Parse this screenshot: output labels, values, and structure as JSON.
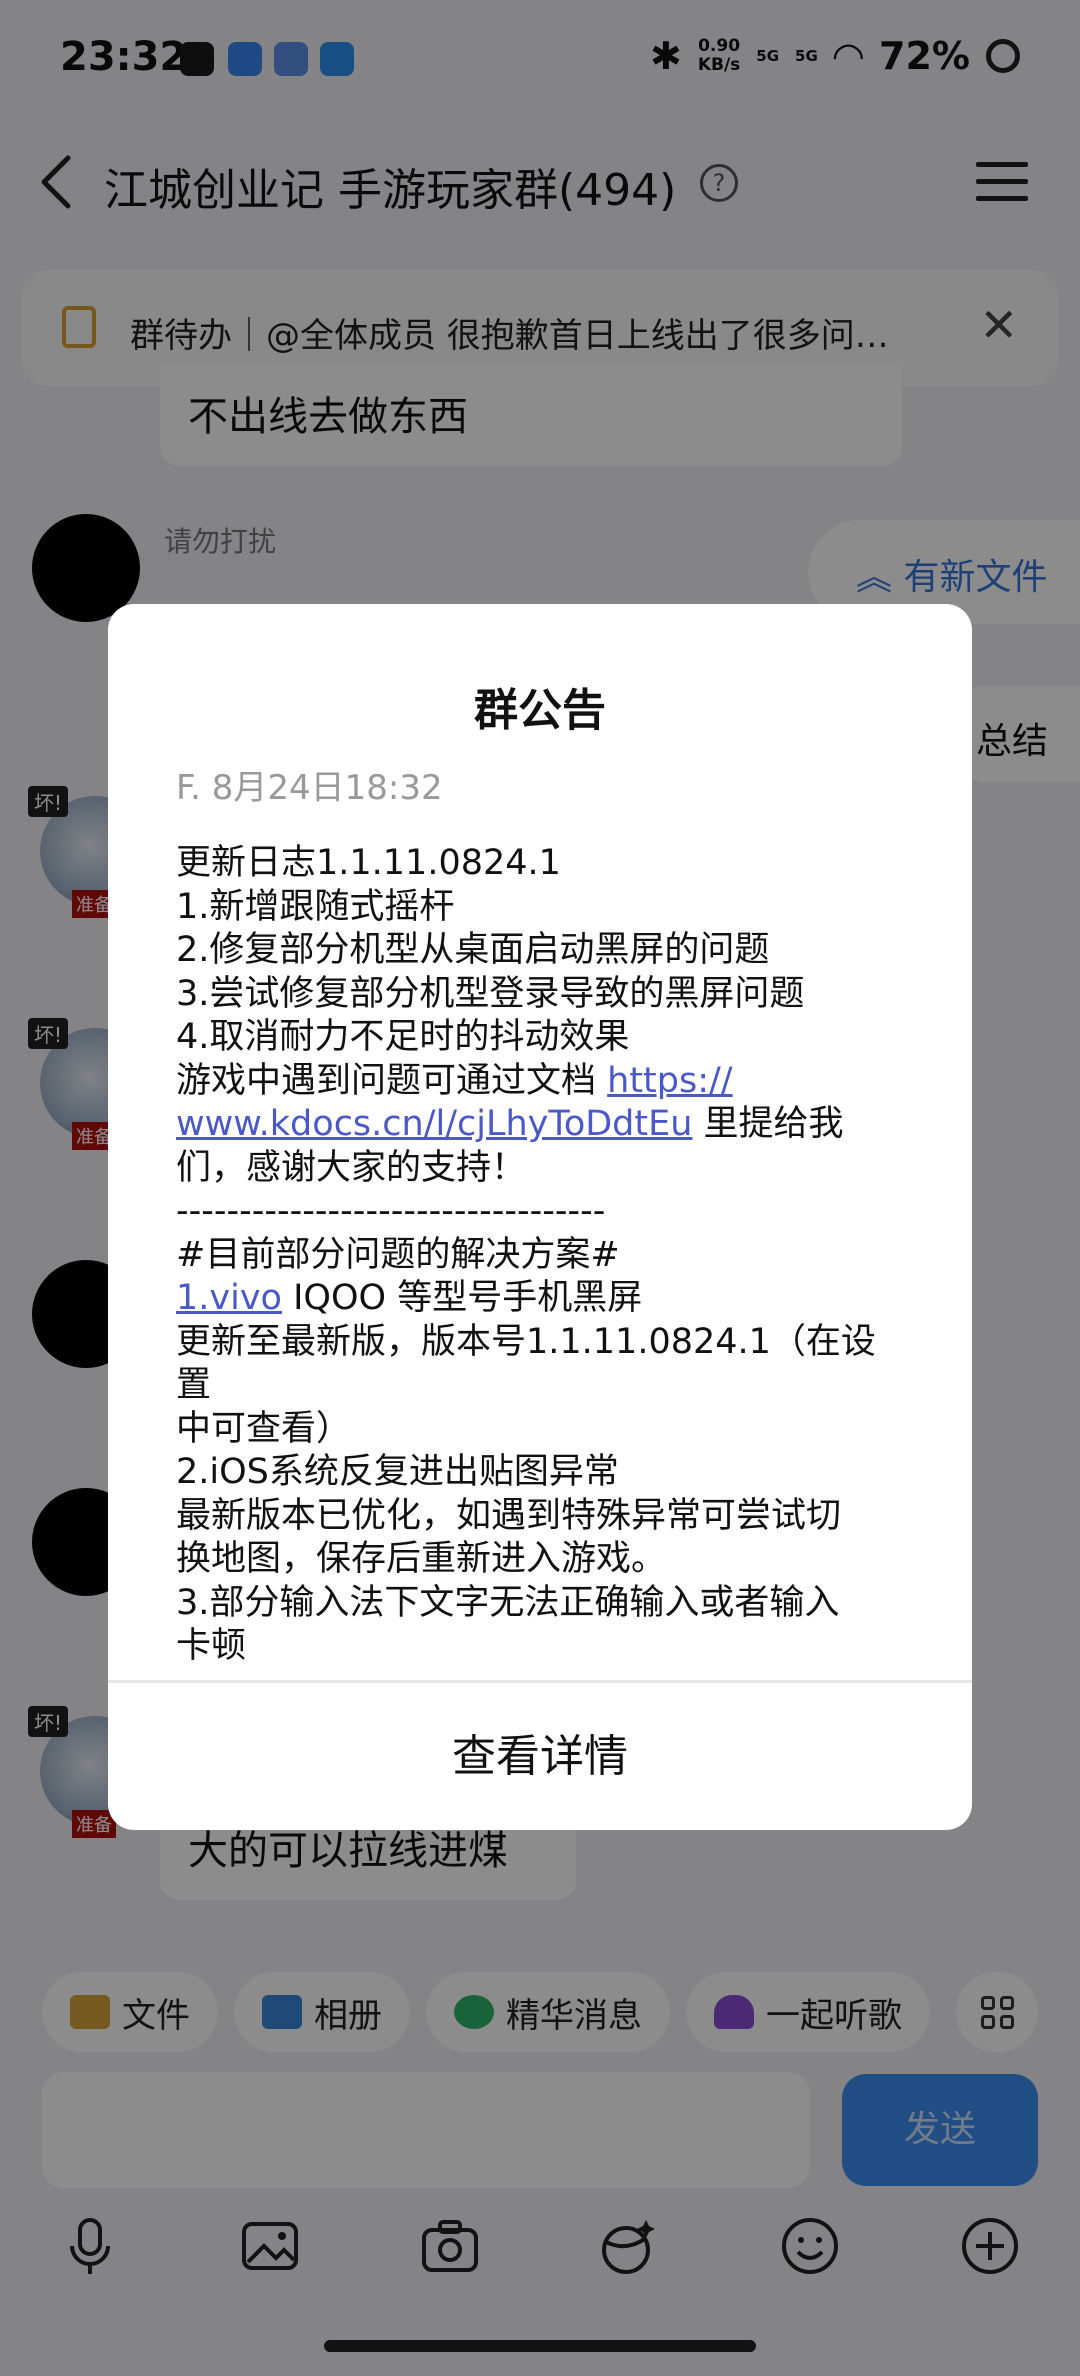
{
  "status_bar": {
    "time": "23:32",
    "speed_value": "0.90",
    "speed_unit": "KB/s",
    "sim1": "5G",
    "sim2": "5G",
    "battery": "72%"
  },
  "header": {
    "title": "江城创业记 手游玩家群(494)"
  },
  "todo": {
    "text": "群待办｜@全体成员 很抱歉首日上线出了很多问…"
  },
  "chat": {
    "bubble_top": "不出线去做东西",
    "nickname": "请勿打扰",
    "new_files": "有新文件",
    "summary": "总结",
    "bubble_bottom": "大的可以拉线进煤",
    "avatar_tag_top": "坏!",
    "avatar_tag_bottom": "准备"
  },
  "toolbar": {
    "chips": [
      {
        "label": "文件",
        "color": "#d8a23a"
      },
      {
        "label": "相册",
        "color": "#3a86d8"
      },
      {
        "label": "精华消息",
        "color": "#2fb36a"
      },
      {
        "label": "一起听歌",
        "color": "#8a4bd6"
      }
    ],
    "send_label": "发送"
  },
  "dialog": {
    "title": "群公告",
    "meta": "F. 8月24日18:32",
    "lines": [
      "更新日志1.1.11.0824.1",
      "1.新增跟随式摇杆",
      "2.修复部分机型从桌面启动黑屏的问题",
      "3.尝试修复部分机型登录导致的黑屏问题",
      "4.取消耐力不足时的抖动效果"
    ],
    "line_link_prefix": "游戏中遇到问题可通过文档 ",
    "link_part1": "https://",
    "link_part2": "www.kdocs.cn/l/cjLhyToDdtEu",
    "link_suffix": " 里提给我",
    "line_thanks": "们，感谢大家的支持！",
    "separator": "----------------------------------",
    "line_solutions": "#目前部分问题的解决方案#",
    "vivo_link": "1.vivo",
    "vivo_rest": " IQOO 等型号手机黑屏",
    "lines2": [
      "更新至最新版，版本号1.1.11.0824.1（在设置",
      "中可查看）",
      "2.iOS系统反复进出贴图异常",
      "最新版本已优化，如遇到特殊异常可尝试切",
      "换地图，保存后重新进入游戏。",
      "3.部分输入法下文字无法正确输入或者输入",
      "卡顿"
    ],
    "button": "查看详情"
  }
}
